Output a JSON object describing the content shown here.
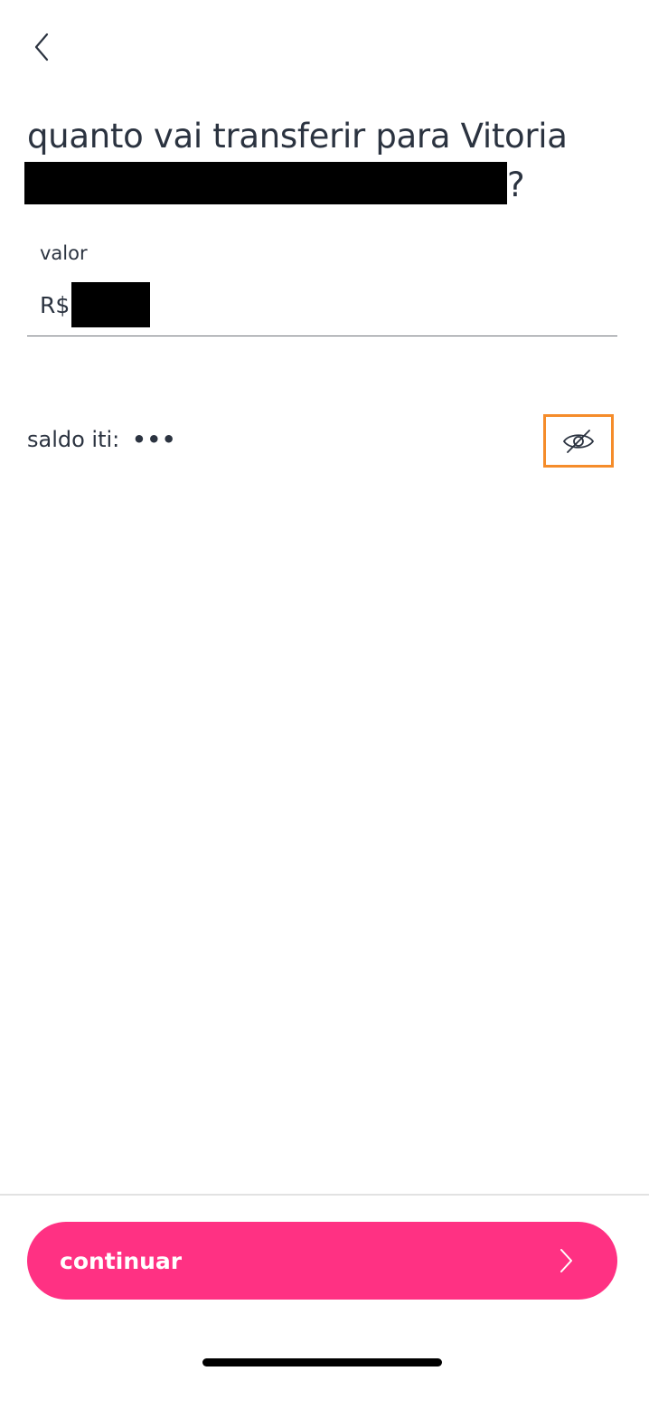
{
  "header": {
    "back_icon": "chevron-left-icon"
  },
  "title": {
    "text": "quanto vai transferir para Vitoria",
    "suffix": "?"
  },
  "amount_field": {
    "label": "valor",
    "currency": "R$"
  },
  "balance": {
    "label": "saldo iti:",
    "masked_value": "•••",
    "toggle_icon": "eye-off-icon"
  },
  "footer": {
    "continue_label": "continuar",
    "continue_icon": "chevron-right-icon"
  },
  "colors": {
    "primary": "#ff3183",
    "text": "#2b3340",
    "highlight": "#f58c2a"
  }
}
